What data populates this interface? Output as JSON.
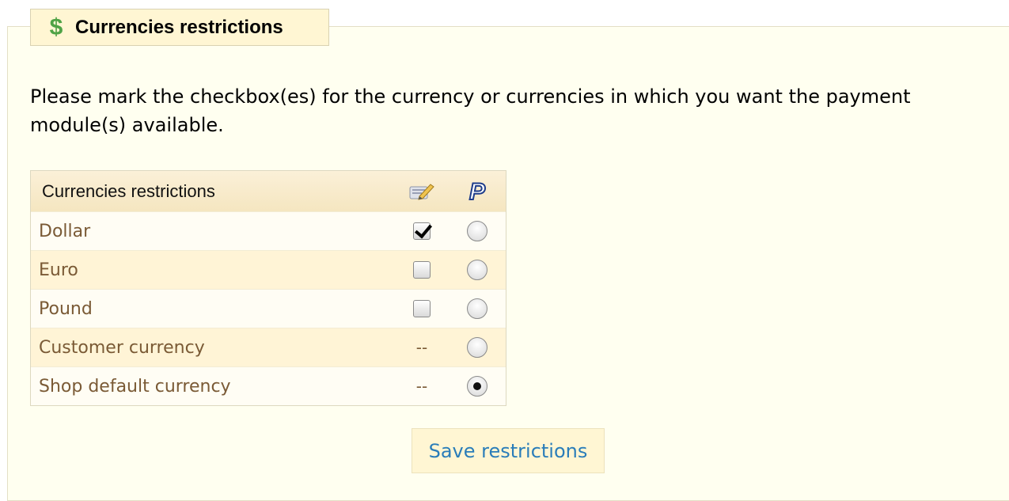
{
  "section": {
    "title": "Currencies restrictions",
    "icon": "dollar-icon",
    "icon_glyph": "$",
    "description": "Please mark the checkbox(es) for the currency or currencies in which you want the payment module(s) available."
  },
  "table": {
    "header": {
      "label": "Currencies restrictions",
      "columns": [
        {
          "icon": "module-edit-icon"
        },
        {
          "icon": "paypal-icon",
          "glyph": "P"
        }
      ]
    },
    "rows": [
      {
        "label": "Dollar",
        "module_checkbox": true,
        "module_dash": "",
        "paypal_radio": false
      },
      {
        "label": "Euro",
        "module_checkbox": false,
        "module_dash": "",
        "paypal_radio": false
      },
      {
        "label": "Pound",
        "module_checkbox": false,
        "module_dash": "",
        "paypal_radio": false
      },
      {
        "label": "Customer currency",
        "module_checkbox": null,
        "module_dash": "--",
        "paypal_radio": false
      },
      {
        "label": "Shop default currency",
        "module_checkbox": null,
        "module_dash": "--",
        "paypal_radio": true
      }
    ]
  },
  "save_button": {
    "label": "Save restrictions"
  },
  "colors": {
    "panel_bg": "#fffff0",
    "row_alt": "#fff4d6",
    "row_label": "#7a5a35",
    "button_text": "#2a7db9",
    "dollar_icon": "#4fa346",
    "paypal": "#1e3c8a"
  }
}
